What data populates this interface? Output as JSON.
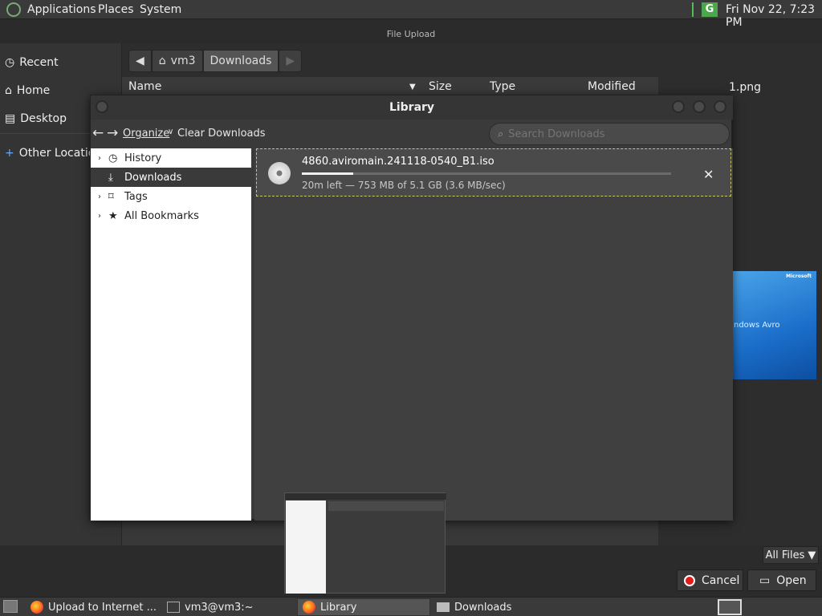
{
  "top_panel": {
    "menus": [
      "Applications",
      "Places",
      "System"
    ],
    "clock": "Fri Nov 22,  7:23 PM"
  },
  "file_upload": {
    "title": "File Upload",
    "sidebar": [
      "Recent",
      "Home",
      "Desktop",
      "Other Locations"
    ],
    "path": [
      "vm3",
      "Downloads"
    ],
    "columns": [
      "Name",
      "Size",
      "Type",
      "Modified"
    ],
    "right_file": "1.png",
    "thumb_text_brand": "Microsoft",
    "thumb_text_product": "ndows Avro",
    "filter": "All Files",
    "cancel": "Cancel",
    "open": "Open"
  },
  "library": {
    "title": "Library",
    "organize": "Organize",
    "clear": "Clear Downloads",
    "search_placeholder": "Search Downloads",
    "tree": [
      "History",
      "Downloads",
      "Tags",
      "All Bookmarks"
    ],
    "download": {
      "name": "4860.aviromain.241118-0540_B1.iso",
      "status": "20m left — 753 MB of 5.1 GB (3.6 MB/sec)",
      "progress": 0.14
    }
  },
  "taskbar": {
    "tasks": [
      "Upload to Internet ...",
      "vm3@vm3:~",
      "Library",
      "Downloads"
    ]
  }
}
